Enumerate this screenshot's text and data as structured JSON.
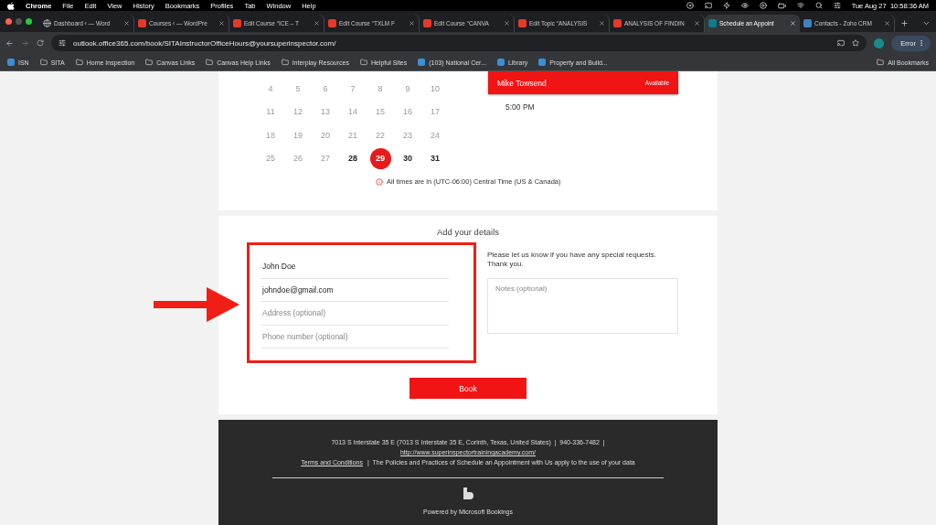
{
  "menubar": {
    "app": "Chrome",
    "menus": [
      "File",
      "Edit",
      "View",
      "History",
      "Bookmarks",
      "Profiles",
      "Tab",
      "Window",
      "Help"
    ],
    "clock": "Tue Aug 27  10:58:36 AM"
  },
  "tabs": [
    {
      "title": "Dashboard ‹ — Word",
      "kind": "globe",
      "selected": false
    },
    {
      "title": "Courses ‹ — WordPre",
      "kind": "site",
      "selected": false
    },
    {
      "title": "Edit Course “ICE – T",
      "kind": "site",
      "selected": false
    },
    {
      "title": "Edit Course “TXLM F",
      "kind": "site",
      "selected": false
    },
    {
      "title": "Edit Course “CANVA",
      "kind": "site",
      "selected": false
    },
    {
      "title": "Edit Topic “ANALYSIS",
      "kind": "site",
      "selected": false
    },
    {
      "title": "ANALYSIS OF FINDIN",
      "kind": "site",
      "selected": false
    },
    {
      "title": "Schedule an Appoint",
      "kind": "bookings",
      "selected": true
    },
    {
      "title": "Contacts - Zoho CRM",
      "kind": "crm",
      "selected": false
    }
  ],
  "address": {
    "url": "outlook.office365.com/book/SITAInstructorOfficeHours@yoursuperinspector.com/",
    "profile": "Error"
  },
  "bookmarks": [
    {
      "label": "ISN",
      "kind": "site"
    },
    {
      "label": "SITA",
      "kind": "folder"
    },
    {
      "label": "Home Inspection",
      "kind": "folder"
    },
    {
      "label": "Canvas Links",
      "kind": "folder"
    },
    {
      "label": "Canvas Help Links",
      "kind": "folder"
    },
    {
      "label": "Interplay Resources",
      "kind": "folder"
    },
    {
      "label": "Helpful Sites",
      "kind": "folder"
    },
    {
      "label": "(103) National Cer...",
      "kind": "site"
    },
    {
      "label": "Library",
      "kind": "site"
    },
    {
      "label": "Property and Build...",
      "kind": "site"
    }
  ],
  "all_bookmarks": "All Bookmarks",
  "calendar": {
    "weeks": [
      [
        {
          "day": "4",
          "available": false,
          "selected": false
        },
        {
          "day": "5",
          "available": false,
          "selected": false
        },
        {
          "day": "6",
          "available": false,
          "selected": false
        },
        {
          "day": "7",
          "available": false,
          "selected": false
        },
        {
          "day": "8",
          "available": false,
          "selected": false
        },
        {
          "day": "9",
          "available": false,
          "selected": false
        },
        {
          "day": "10",
          "available": false,
          "selected": false
        }
      ],
      [
        {
          "day": "11",
          "available": false,
          "selected": false
        },
        {
          "day": "12",
          "available": false,
          "selected": false
        },
        {
          "day": "13",
          "available": false,
          "selected": false
        },
        {
          "day": "14",
          "available": false,
          "selected": false
        },
        {
          "day": "15",
          "available": false,
          "selected": false
        },
        {
          "day": "16",
          "available": false,
          "selected": false
        },
        {
          "day": "17",
          "available": false,
          "selected": false
        }
      ],
      [
        {
          "day": "18",
          "available": false,
          "selected": false
        },
        {
          "day": "19",
          "available": false,
          "selected": false
        },
        {
          "day": "20",
          "available": false,
          "selected": false
        },
        {
          "day": "21",
          "available": false,
          "selected": false
        },
        {
          "day": "22",
          "available": false,
          "selected": false
        },
        {
          "day": "23",
          "available": false,
          "selected": false
        },
        {
          "day": "24",
          "available": false,
          "selected": false
        }
      ],
      [
        {
          "day": "25",
          "available": false,
          "selected": false
        },
        {
          "day": "26",
          "available": false,
          "selected": false
        },
        {
          "day": "27",
          "available": false,
          "selected": false
        },
        {
          "day": "28",
          "available": true,
          "selected": false
        },
        {
          "day": "29",
          "available": true,
          "selected": true
        },
        {
          "day": "30",
          "available": true,
          "selected": false
        },
        {
          "day": "31",
          "available": true,
          "selected": false
        }
      ]
    ],
    "timezone": "All times are in (UTC-06:00) Central Time (US & Canada)"
  },
  "staff": {
    "name": "Mike Towsend",
    "status": "Available",
    "selected": true
  },
  "times": [
    "5:00 PM"
  ],
  "details": {
    "heading": "Add your details",
    "fields": [
      {
        "value": "John Doe"
      },
      {
        "value": "johndoe@gmail.com"
      },
      {
        "placeholder": "Address (optional)"
      },
      {
        "placeholder": "Phone number (optional)"
      }
    ],
    "note": "Please let us know if you have any special requests. Thank you.",
    "notes_placeholder": "Notes (optional)",
    "book": "Book"
  },
  "footer": {
    "address": "7013 S Interstate 35 E (7013 S Interstate 35 E, Corinth, Texas, United States)  |  940-336-7482  |",
    "website": "http://www.superinspectortrainingacademy.com/",
    "terms": "Terms and Conditions",
    "policy": "|  The Policies and Practices of Schedule an Appointment with Us apply to the use of your data",
    "powered": "Powered by Microsoft Bookings"
  }
}
